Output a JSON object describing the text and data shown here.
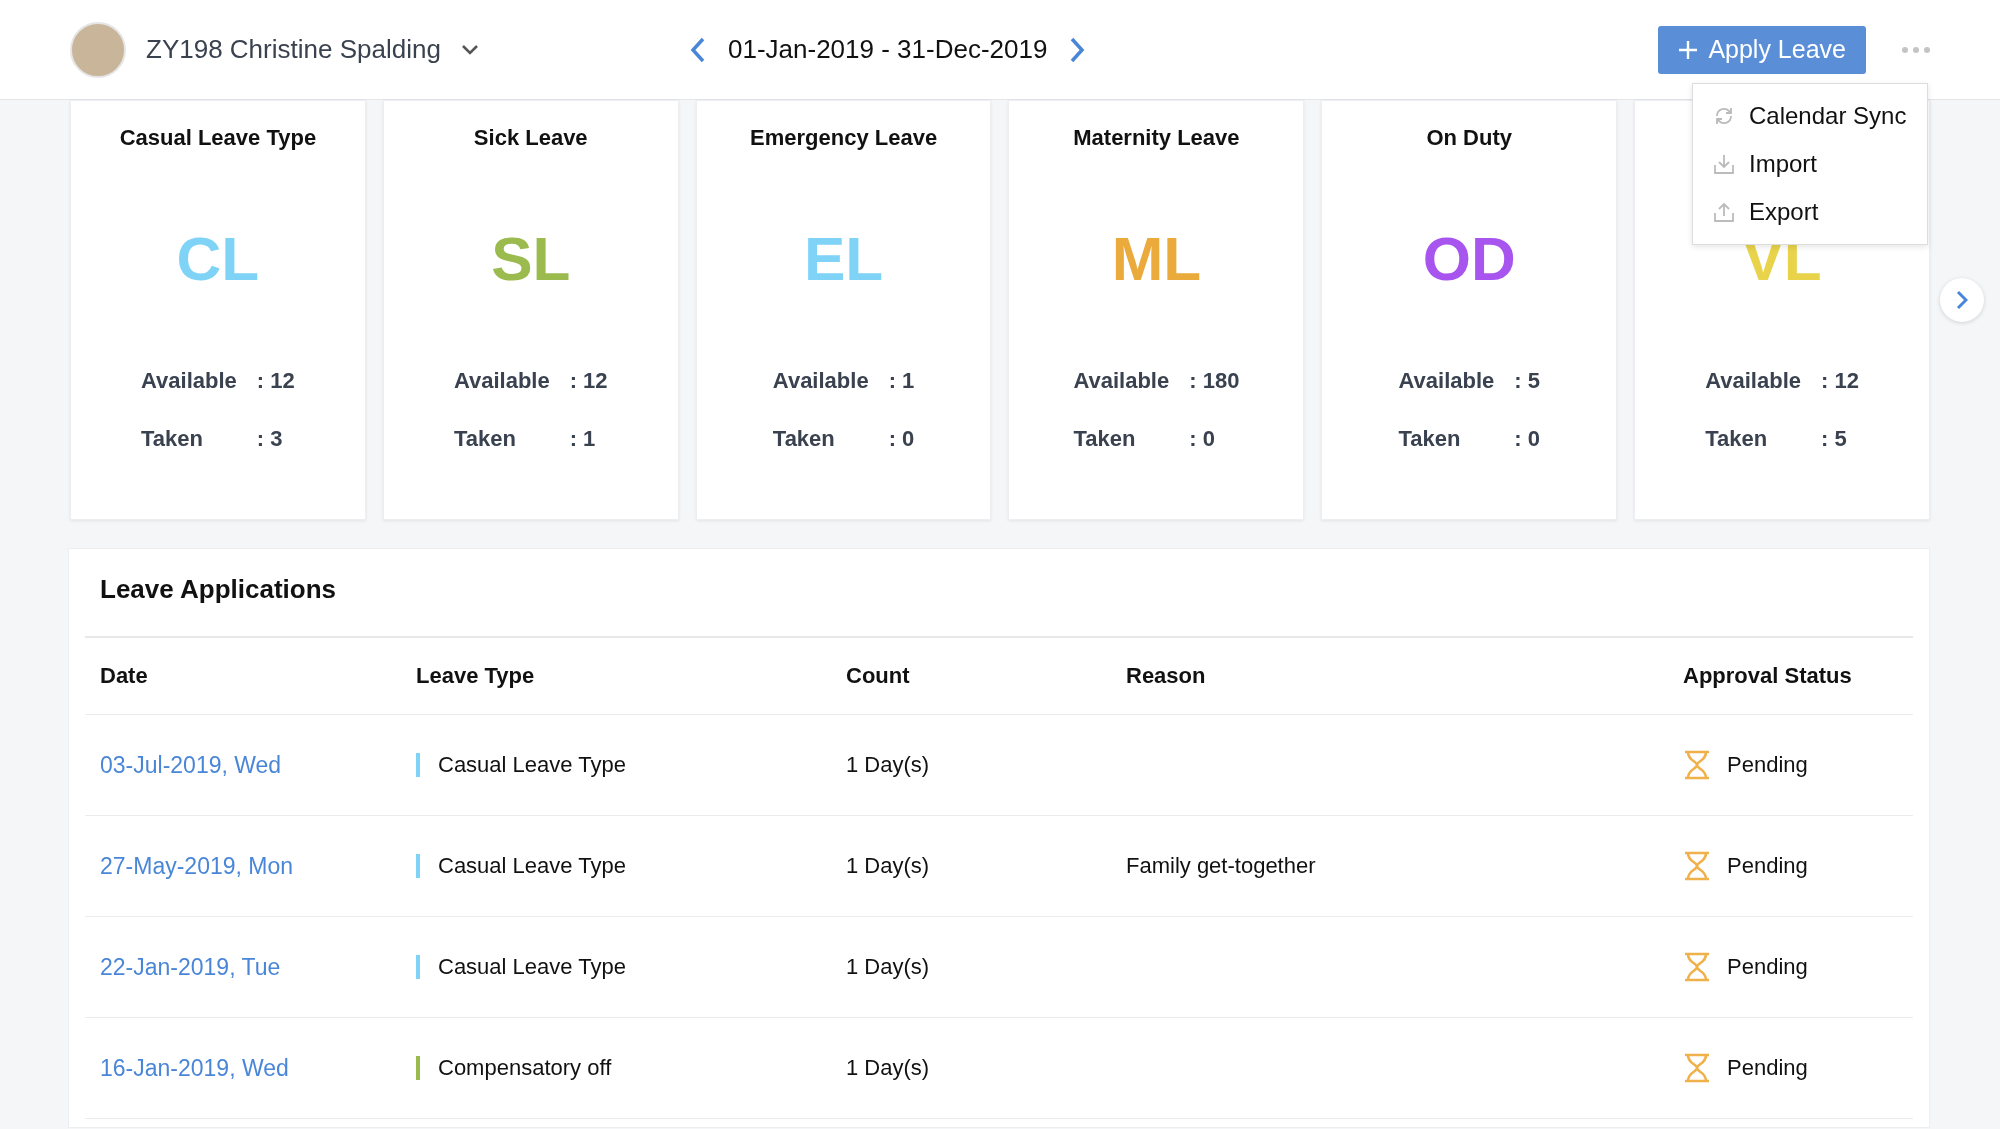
{
  "header": {
    "employee": "ZY198 Christine Spalding",
    "period": "01-Jan-2019 - 31-Dec-2019",
    "apply_button": "Apply Leave",
    "more_menu": {
      "open": true,
      "items": [
        {
          "kind": "sync",
          "label": "Calendar Sync"
        },
        {
          "kind": "import",
          "label": "Import"
        },
        {
          "kind": "export",
          "label": "Export"
        }
      ]
    }
  },
  "leave_cards": [
    {
      "title": "Casual Leave Type",
      "code": "CL",
      "color": "#7fd3f7",
      "available_label": "Available",
      "available": ": 12",
      "taken_label": "Taken",
      "taken": ": 3"
    },
    {
      "title": "Sick Leave",
      "code": "SL",
      "color": "#9bbb4f",
      "available_label": "Available",
      "available": ": 12",
      "taken_label": "Taken",
      "taken": ": 1"
    },
    {
      "title": "Emergency Leave",
      "code": "EL",
      "color": "#7fd3f7",
      "available_label": "Available",
      "available": ": 1",
      "taken_label": "Taken",
      "taken": ": 0"
    },
    {
      "title": "Maternity Leave",
      "code": "ML",
      "color": "#eaaa3c",
      "available_label": "Available",
      "available": ": 180",
      "taken_label": "Taken",
      "taken": ": 0"
    },
    {
      "title": "On Duty",
      "code": "OD",
      "color": "#a855f0",
      "available_label": "Available",
      "available": ": 5",
      "taken_label": "Taken",
      "taken": ": 0"
    },
    {
      "code": "VL",
      "color": "#e8d34a",
      "available_label": "Available",
      "available": ": 12",
      "taken_label": "Taken",
      "taken": ": 5"
    }
  ],
  "leave_applications": {
    "title": "Leave Applications",
    "columns": [
      "Date",
      "Leave Type",
      "Count",
      "Reason",
      "Approval Status"
    ],
    "rows": [
      {
        "date": "03-Jul-2019, Wed",
        "leave_type": "Casual Leave Type",
        "color": "#7fd3f7",
        "count": "1 Day(s)",
        "status": "Pending"
      },
      {
        "date": "27-May-2019, Mon",
        "leave_type": "Casual Leave Type",
        "color": "#7fd3f7",
        "count": "1 Day(s)",
        "reason": "Family get-together",
        "status": "Pending"
      },
      {
        "date": "22-Jan-2019, Tue",
        "leave_type": "Casual Leave Type",
        "color": "#7fd3f7",
        "count": "1 Day(s)",
        "status": "Pending"
      },
      {
        "date": "16-Jan-2019, Wed",
        "leave_type": "Compensatory off",
        "color": "#9bbb4f",
        "count": "1 Day(s)",
        "status": "Pending"
      }
    ]
  }
}
